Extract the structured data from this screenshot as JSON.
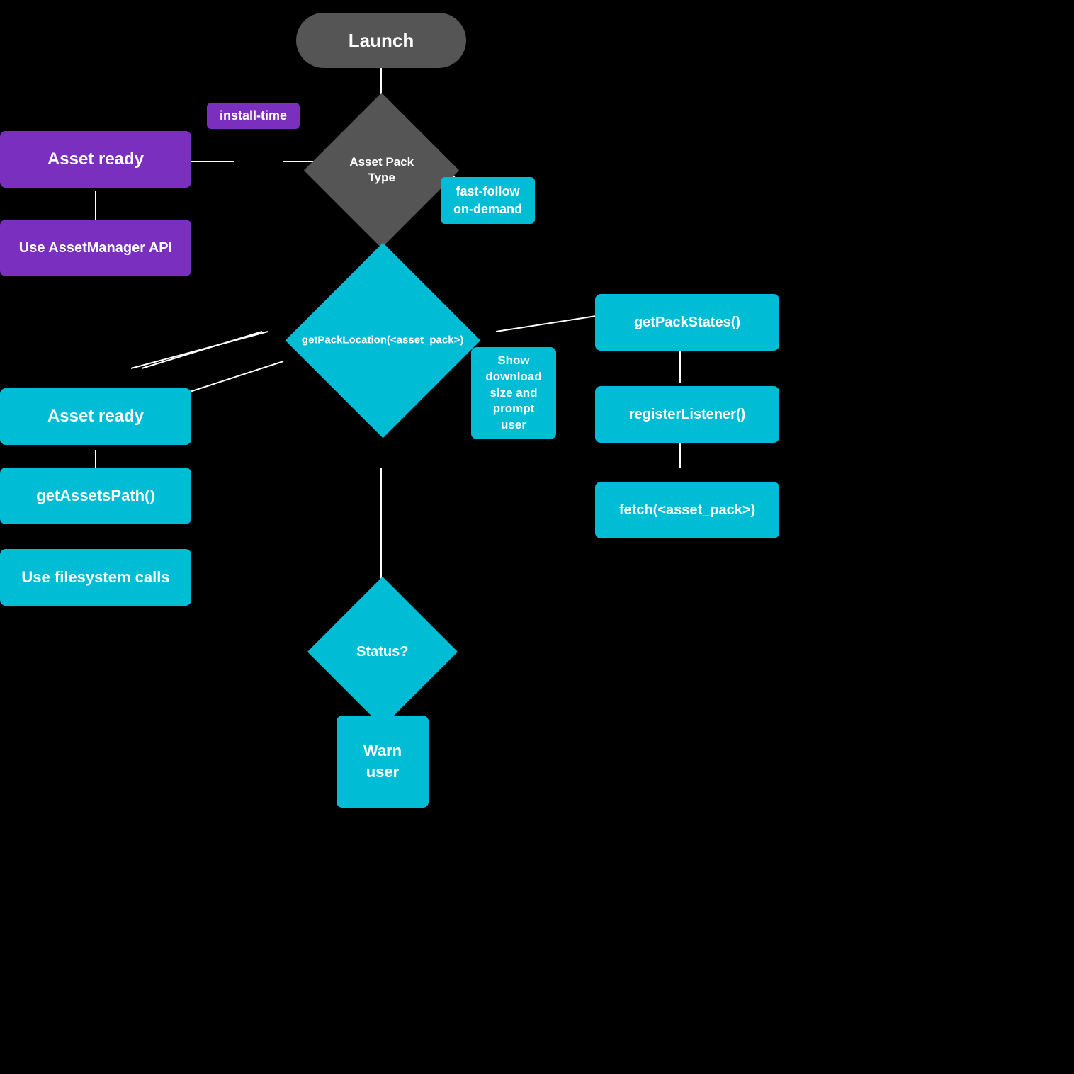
{
  "nodes": {
    "launch": {
      "label": "Launch"
    },
    "asset_pack_type": {
      "label": "Asset Pack\nType"
    },
    "install_time_tag": {
      "label": "install-time"
    },
    "fast_follow_tag": {
      "label": "fast-follow\non-demand"
    },
    "asset_ready_1": {
      "label": "Asset ready"
    },
    "use_asset_manager": {
      "label": "Use AssetManager API"
    },
    "get_pack_location": {
      "label": "getPackLocation(<asset_pack>)"
    },
    "asset_ready_2": {
      "label": "Asset ready"
    },
    "get_assets_path": {
      "label": "getAssetsPath()"
    },
    "use_filesystem": {
      "label": "Use filesystem calls"
    },
    "show_download": {
      "label": "Show\ndownload\nsize and\nprompt\nuser"
    },
    "get_pack_states": {
      "label": "getPackStates()"
    },
    "register_listener": {
      "label": "registerListener()"
    },
    "fetch_asset_pack": {
      "label": "fetch(<asset_pack>)"
    },
    "status": {
      "label": "Status?"
    },
    "warn_user": {
      "label": "Warn\nuser"
    }
  }
}
